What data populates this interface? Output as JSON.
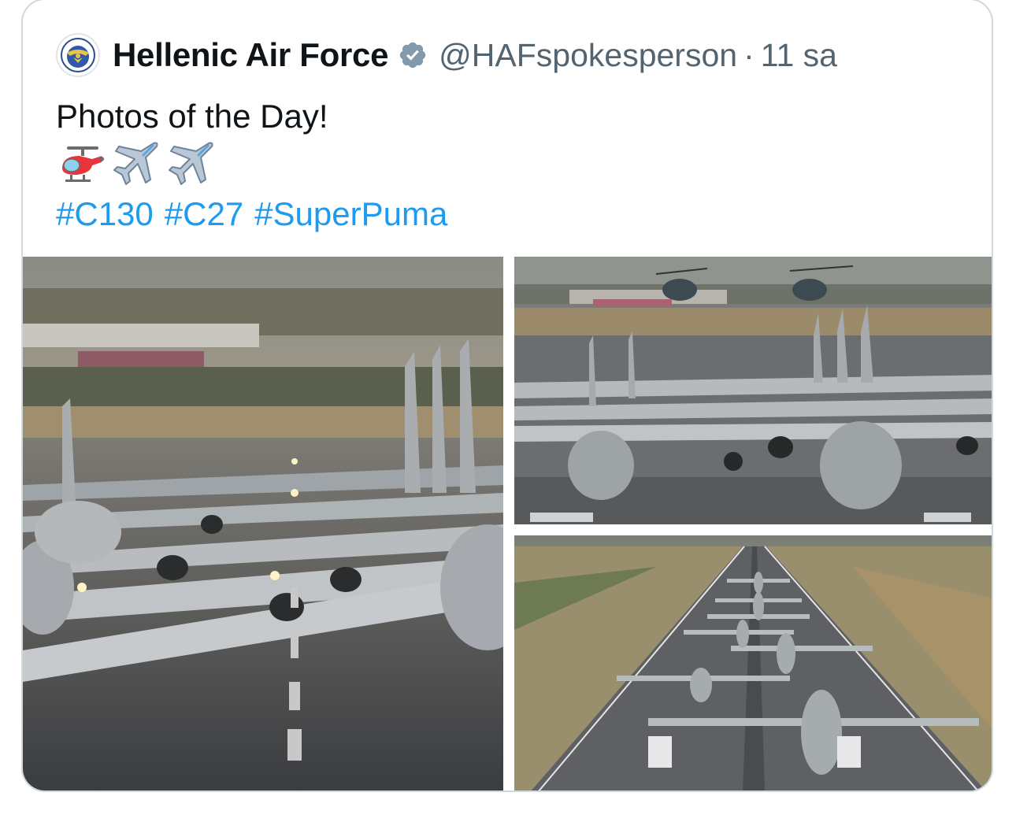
{
  "tweet": {
    "author_name": "Hellenic Air Force",
    "handle": "@HAFspokesperson",
    "separator": "·",
    "time": "11 sa",
    "text": "Photos of the Day!",
    "emojis": [
      "helicopter-icon",
      "airplane-icon",
      "airplane-icon"
    ],
    "hashtags": [
      "#C130",
      "#C27",
      "#SuperPuma"
    ],
    "photos": [
      {
        "name": "photo-c130-lineup-closeup"
      },
      {
        "name": "photo-runway-helicopters"
      },
      {
        "name": "photo-runway-aerial"
      }
    ]
  },
  "colors": {
    "link": "#1d9bf0",
    "secondary_text": "#536471",
    "border": "#cfd9de",
    "verified_badge": "#829aab"
  }
}
